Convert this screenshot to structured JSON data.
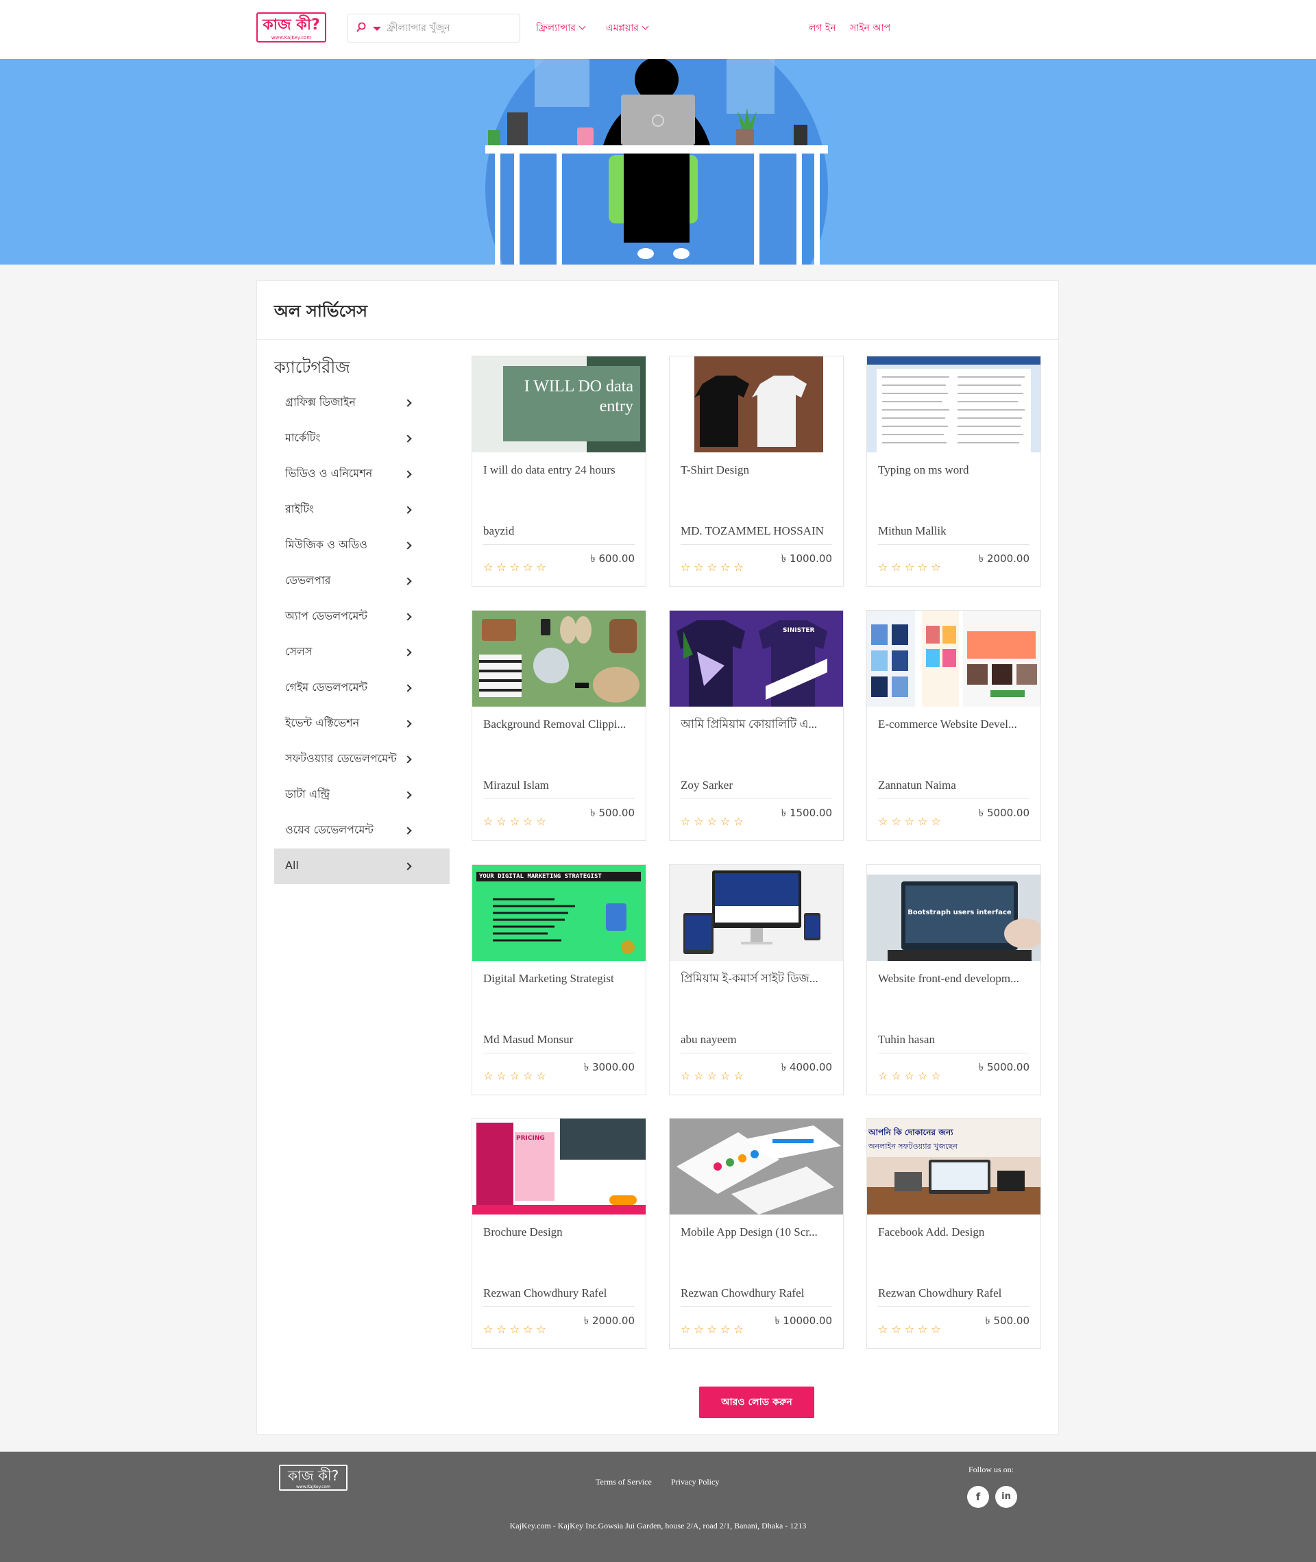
{
  "header": {
    "logo_text": "কাজ কী?",
    "logo_sub": "www.KajKey.com",
    "search_placeholder": "ফ্রীল্যান্সার খুঁজুন",
    "nav_freelancer": "ফ্রিল্যান্সার",
    "nav_employer": "এমপ্লয়ার",
    "login": "লগ ইন",
    "signup": "সাইন আপ"
  },
  "main": {
    "title": "অল সার্ভিসেস",
    "categories_title": "ক্যাটেগরীজ",
    "categories": [
      "গ্রাফিক্স ডিজাইন",
      "মার্কেটিং",
      "ভিডিও ও এনিমেশন",
      "রাইটিং",
      "মিউজিক ও অডিও",
      "ডেভলপার",
      "অ্যাপ ডেভলপমেন্ট",
      "সেলস",
      "গেইম ডেভলপমেন্ট",
      "ইভেন্ট এক্টিভেশন",
      "সফটওয়্যার ডেভেলপমেন্ট",
      "ডাটা এন্ট্রি",
      "ওয়েব ডেভেলপমেন্ট",
      "All"
    ],
    "active_category": "All",
    "load_more": "আরও লোড করুন",
    "thumb_data_entry": "I WILL DO data entry",
    "thumb_digital_marketing": "YOUR DIGITAL MARKETING STRATEGIST",
    "thumb_bootstrap": "Bootstraph users interface",
    "thumb_shop_line1": "আপনি কি দোকানের জন্য",
    "thumb_shop_line2": "অনলাইন সফটওয়্যার খুজছেন",
    "thumb_pricing": "PRICING",
    "thumb_sinister": "SINISTER"
  },
  "services": [
    {
      "title": "I will do data entry 24 hours",
      "seller": "bayzid",
      "price": "৳ 600.00",
      "stars": "☆☆☆☆☆"
    },
    {
      "title": "T-Shirt Design",
      "seller": "MD. TOZAMMEL HOSSAIN",
      "price": "৳ 1000.00",
      "stars": "☆☆☆☆☆"
    },
    {
      "title": "Typing on ms word",
      "seller": "Mithun Mallik",
      "price": "৳ 2000.00",
      "stars": "☆☆☆☆☆"
    },
    {
      "title": "Background Removal Clippi...",
      "seller": "Mirazul Islam",
      "price": "৳ 500.00",
      "stars": "☆☆☆☆☆"
    },
    {
      "title": "আমি প্রিমিয়াম কোয়ালিটি এ...",
      "seller": "Zoy Sarker",
      "price": "৳ 1500.00",
      "stars": "☆☆☆☆☆"
    },
    {
      "title": "E-commerce Website Devel...",
      "seller": "Zannatun Naima",
      "price": "৳ 5000.00",
      "stars": "☆☆☆☆☆"
    },
    {
      "title": "Digital Marketing Strategist",
      "seller": "Md Masud Monsur",
      "price": "৳ 3000.00",
      "stars": "☆☆☆☆☆"
    },
    {
      "title": "প্রিমিয়াম ই-কমার্স সাইট ডিজ...",
      "seller": "abu nayeem",
      "price": "৳ 4000.00",
      "stars": "☆☆☆☆☆"
    },
    {
      "title": "Website front-end developm...",
      "seller": "Tuhin hasan",
      "price": "৳ 5000.00",
      "stars": "☆☆☆☆☆"
    },
    {
      "title": "Brochure Design",
      "seller": "Rezwan Chowdhury Rafel",
      "price": "৳ 2000.00",
      "stars": "☆☆☆☆☆"
    },
    {
      "title": "Mobile App Design (10 Scr...",
      "seller": "Rezwan Chowdhury Rafel",
      "price": "৳ 10000.00",
      "stars": "☆☆☆☆☆"
    },
    {
      "title": "Facebook Add. Design",
      "seller": "Rezwan Chowdhury Rafel",
      "price": "৳ 500.00",
      "stars": "☆☆☆☆☆"
    }
  ],
  "footer": {
    "logo_text": "কাজ কী?",
    "logo_sub": "www.KajKey.com",
    "terms": "Terms of Service",
    "privacy": "Privacy Policy",
    "follow": "Follow us on:",
    "facebook_glyph": "f",
    "linkedin_glyph": "in",
    "address": "KajKey.com - KajKey Inc.Gowsia Jui Garden, house 2/A, road 2/1, Banani, Dhaka - 1213"
  },
  "colors": {
    "accent": "#e91e63",
    "banner": "#6ab0f3",
    "footer": "#646464",
    "star": "#f39c12"
  },
  "icons": [
    "search-icon",
    "caret-down-icon",
    "chevron-down-icon",
    "chevron-right-icon",
    "star-icon",
    "facebook-icon",
    "linkedin-icon"
  ]
}
